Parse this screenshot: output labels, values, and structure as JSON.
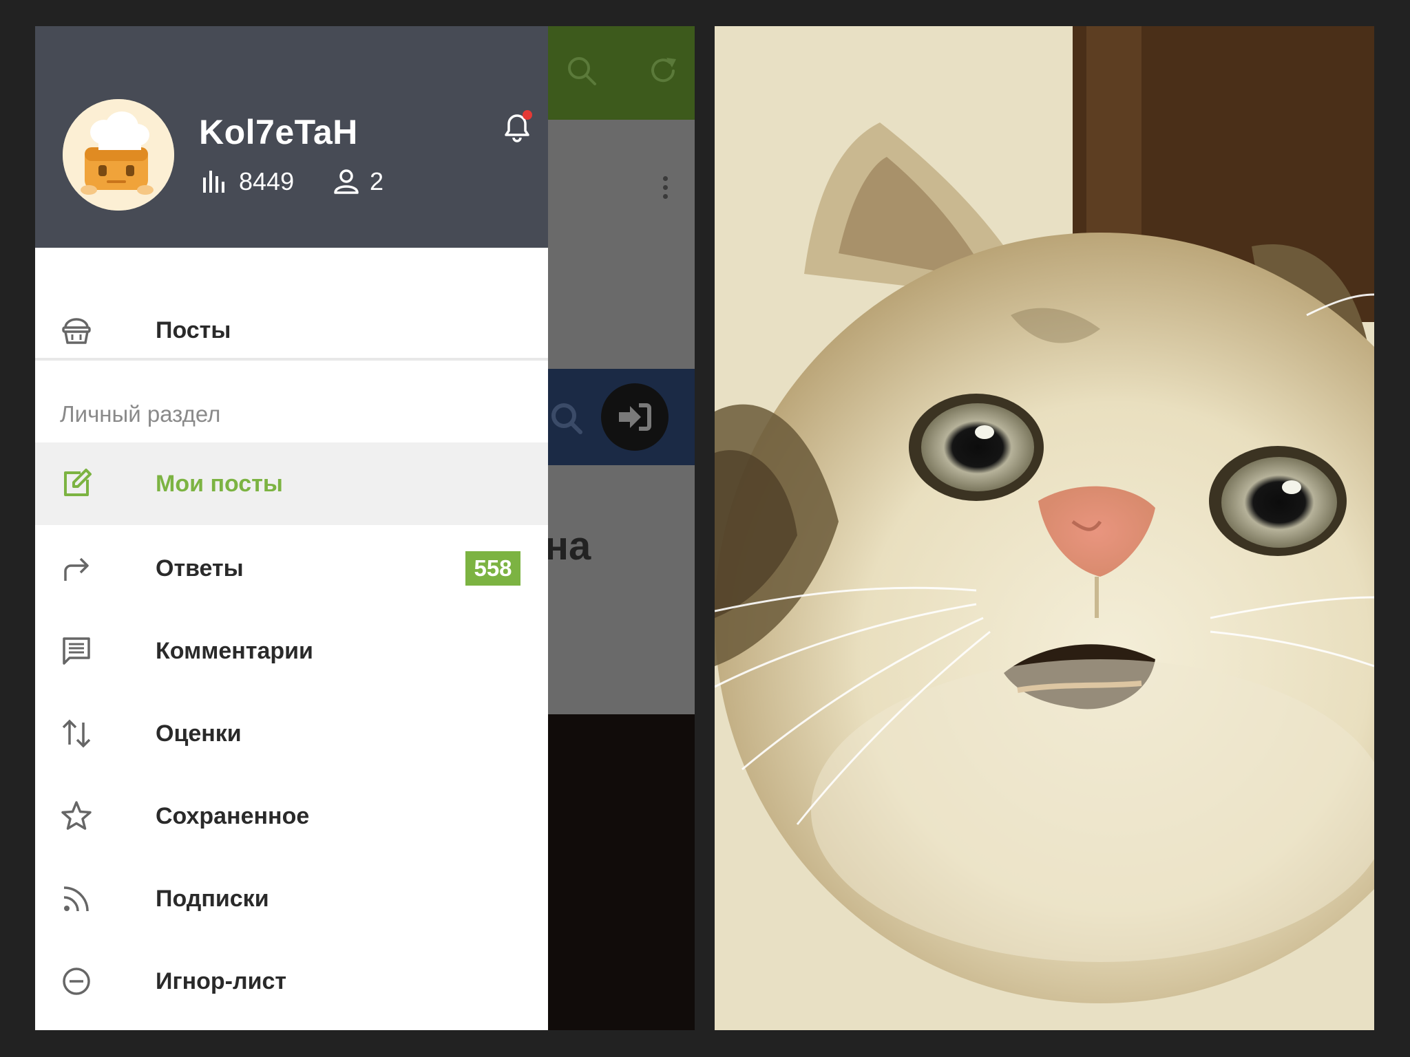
{
  "profile": {
    "username": "Kol7eTaH",
    "rating": "8449",
    "subscribers": "2"
  },
  "menu": {
    "posts": "Посты",
    "section_title": "Личный раздел",
    "items": [
      {
        "label": "Мои посты",
        "icon": "edit-icon",
        "active": true
      },
      {
        "label": "Ответы",
        "icon": "reply-icon",
        "badge": "558"
      },
      {
        "label": "Комментарии",
        "icon": "comment-icon"
      },
      {
        "label": "Оценки",
        "icon": "sort-arrows-icon"
      },
      {
        "label": "Сохраненное",
        "icon": "star-icon"
      },
      {
        "label": "Подписки",
        "icon": "rss-icon"
      },
      {
        "label": "Игнор-лист",
        "icon": "block-icon"
      }
    ]
  },
  "background_app": {
    "partial_text": "на"
  },
  "colors": {
    "accent": "#7cb342",
    "header": "#474b55",
    "toolbar": "#3d5a1c",
    "notification": "#e53935"
  }
}
